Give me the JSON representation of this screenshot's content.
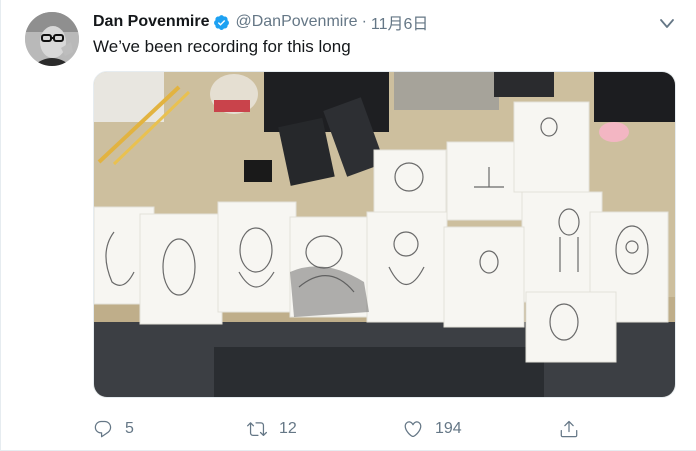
{
  "author": {
    "name": "Dan Povenmire",
    "handle": "@DanPovenmire",
    "date": "11月6日",
    "verified": true
  },
  "tweet": {
    "text": "We’ve been recording for this long"
  },
  "actions": {
    "replies": "5",
    "retweets": "12",
    "likes": "194"
  },
  "colors": {
    "verified_badge": "#1da1f2",
    "muted_text": "#657786",
    "primary_text": "#14171a"
  },
  "icons": [
    "verified-icon",
    "caret-down-icon",
    "reply-icon",
    "retweet-icon",
    "like-icon",
    "share-icon"
  ]
}
